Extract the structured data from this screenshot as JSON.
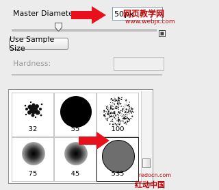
{
  "master_diameter": {
    "label": "Master Diameter",
    "value": "50",
    "unit": "px"
  },
  "sample_size_button": {
    "label": "Use Sample Size"
  },
  "hardness": {
    "label": "Hardness:"
  },
  "brushes": [
    {
      "size": "32",
      "shape": "splatter"
    },
    {
      "size": "55",
      "shape": "hard-round"
    },
    {
      "size": "100",
      "shape": "spatter-dots"
    },
    {
      "size": "75",
      "shape": "soft-round"
    },
    {
      "size": "45",
      "shape": "soft-round"
    },
    {
      "size": "535",
      "shape": "selected-round"
    }
  ],
  "watermarks": {
    "top_text": "网页教学网",
    "top_url": "www.webjx.com",
    "bottom_url": "redocn.com",
    "bottom_text": "红动中国"
  },
  "colors": {
    "arrow": "#e8101a",
    "watermark": "#c00000"
  },
  "icons": {
    "arrow": "red-arrow-icon",
    "new_preset": "page-icon"
  }
}
